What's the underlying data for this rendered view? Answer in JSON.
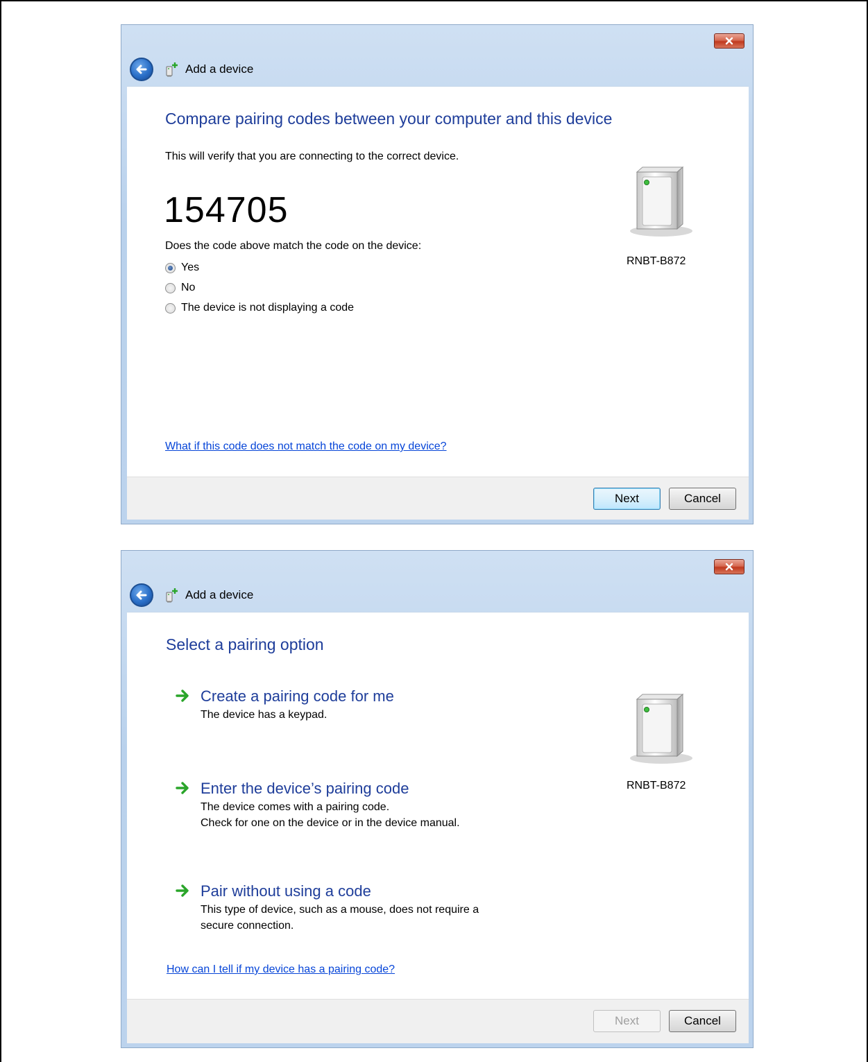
{
  "dialog1": {
    "window_title": "Add a device",
    "heading": "Compare pairing codes between your computer and this device",
    "intro": "This will verify that you are connecting to the correct device.",
    "code": "154705",
    "question": "Does the code above match the code on the device:",
    "options": [
      {
        "label": "Yes",
        "checked": true
      },
      {
        "label": "No",
        "checked": false
      },
      {
        "label": "The device is not displaying a code",
        "checked": false
      }
    ],
    "device_name": "RNBT-B872",
    "help_link": "What if this code does not match the code on my device?",
    "next_label": "Next",
    "cancel_label": "Cancel"
  },
  "dialog2": {
    "window_title": "Add a device",
    "heading": "Select a pairing option",
    "options": [
      {
        "title": "Create a pairing code for me",
        "desc": "The device has a keypad.",
        "desc2": ""
      },
      {
        "title": "Enter the device’s pairing code",
        "desc": "The device comes with a pairing code.",
        "desc2": "Check for one on the device or in the device manual."
      },
      {
        "title": "Pair without using a code",
        "desc": "This type of device, such as a mouse, does not require a",
        "desc2": "secure connection."
      }
    ],
    "device_name": "RNBT-B872",
    "help_link": "How can I tell if my device has a pairing code?",
    "next_label": "Next",
    "cancel_label": "Cancel",
    "next_enabled": false
  },
  "icons": {
    "close": "close-icon",
    "back": "back-arrow-icon",
    "device_small": "device-add-icon",
    "device_large": "bluetooth-device-icon",
    "option_arrow": "green-arrow-icon"
  },
  "colors": {
    "heading": "#1e3d9a",
    "link": "#0645d8",
    "frame": "#bcd3ed",
    "arrow": "#2aa52a"
  }
}
